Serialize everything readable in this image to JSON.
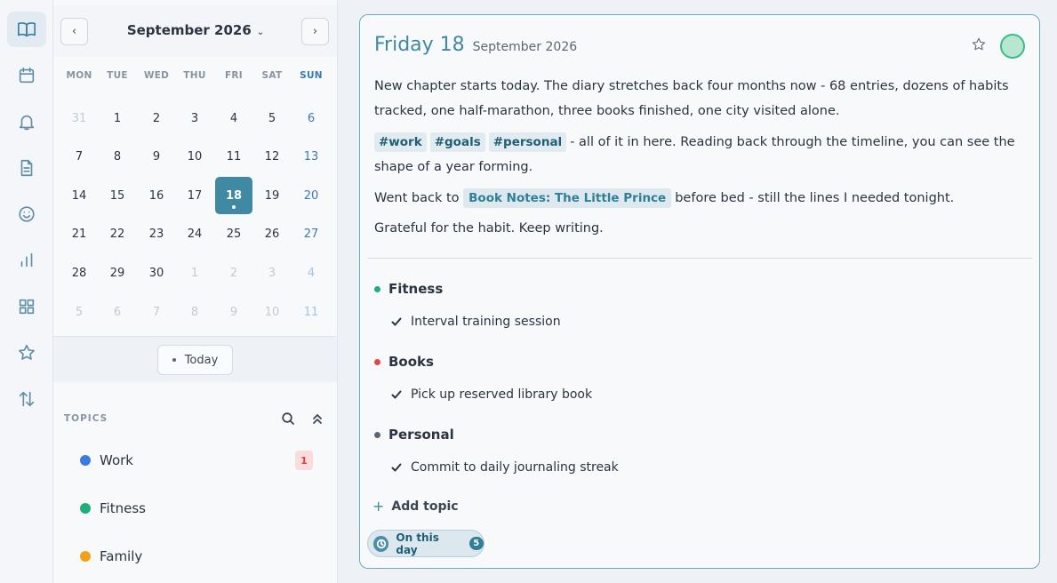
{
  "rail": {
    "items": [
      {
        "name": "journal",
        "icon": "book-open-icon",
        "active": true
      },
      {
        "name": "calendar",
        "icon": "calendar-icon",
        "active": false
      },
      {
        "name": "reminders",
        "icon": "bell-icon",
        "active": false
      },
      {
        "name": "notes",
        "icon": "document-icon",
        "active": false
      },
      {
        "name": "mood",
        "icon": "smiley-icon",
        "active": false
      },
      {
        "name": "stats",
        "icon": "bar-chart-icon",
        "active": false
      },
      {
        "name": "dashboard",
        "icon": "grid-icon",
        "active": false
      },
      {
        "name": "favorites",
        "icon": "star-icon",
        "active": false
      },
      {
        "name": "sync",
        "icon": "arrows-up-down-icon",
        "active": false
      }
    ]
  },
  "calendar": {
    "month_label": "September 2026",
    "prev_icon": "chevron-left-icon",
    "next_icon": "chevron-right-icon",
    "weekdays": [
      "MON",
      "TUE",
      "WED",
      "THU",
      "FRI",
      "SAT",
      "SUN"
    ],
    "weeks": [
      [
        {
          "d": "31",
          "other": true
        },
        {
          "d": "1"
        },
        {
          "d": "2"
        },
        {
          "d": "3"
        },
        {
          "d": "4"
        },
        {
          "d": "5"
        },
        {
          "d": "6"
        }
      ],
      [
        {
          "d": "7"
        },
        {
          "d": "8"
        },
        {
          "d": "9"
        },
        {
          "d": "10"
        },
        {
          "d": "11"
        },
        {
          "d": "12"
        },
        {
          "d": "13"
        }
      ],
      [
        {
          "d": "14"
        },
        {
          "d": "15"
        },
        {
          "d": "16"
        },
        {
          "d": "17"
        },
        {
          "d": "18",
          "selected": true
        },
        {
          "d": "19"
        },
        {
          "d": "20"
        }
      ],
      [
        {
          "d": "21"
        },
        {
          "d": "22"
        },
        {
          "d": "23"
        },
        {
          "d": "24"
        },
        {
          "d": "25"
        },
        {
          "d": "26"
        },
        {
          "d": "27"
        }
      ],
      [
        {
          "d": "28"
        },
        {
          "d": "29"
        },
        {
          "d": "30"
        },
        {
          "d": "1",
          "other": true
        },
        {
          "d": "2",
          "other": true
        },
        {
          "d": "3",
          "other": true
        },
        {
          "d": "4",
          "other": true
        }
      ],
      [
        {
          "d": "5",
          "other": true
        },
        {
          "d": "6",
          "other": true
        },
        {
          "d": "7",
          "other": true
        },
        {
          "d": "8",
          "other": true
        },
        {
          "d": "9",
          "other": true
        },
        {
          "d": "10",
          "other": true
        },
        {
          "d": "11",
          "other": true
        }
      ]
    ],
    "today_label": "Today"
  },
  "topics": {
    "label": "TOPICS",
    "items": [
      {
        "name": "Work",
        "color": "#3b7ae0",
        "badge": "1"
      },
      {
        "name": "Fitness",
        "color": "#1fae7a",
        "badge": ""
      },
      {
        "name": "Family",
        "color": "#f0a11a",
        "badge": ""
      }
    ]
  },
  "entry": {
    "day_title": "Friday 18",
    "month_title": "September 2026",
    "p1": "New chapter starts today. The diary stretches back four months now - 68 entries, dozens of habits tracked, one half-marathon, three books finished, one city visited alone.",
    "tags": [
      "#work",
      "#goals",
      "#personal"
    ],
    "p2_text": "- all of it in here. Reading back through the timeline, you can see the shape of a year forming.",
    "p3_before": "Went back to",
    "p3_link": "Book Notes: The Little Prince",
    "p3_after": "before bed - still the lines I needed tonight.",
    "p4": "Grateful for the habit. Keep writing.",
    "mood_color": "#b8e7d1"
  },
  "timeline": [
    {
      "topic": "Fitness",
      "color": "#1fae7a",
      "task": "Interval training session"
    },
    {
      "topic": "Books",
      "color": "#e04848",
      "task": "Pick up reserved library book"
    },
    {
      "topic": "Personal",
      "color": "#5c6673",
      "task": "Commit to daily journaling streak"
    }
  ],
  "add_topic_label": "Add topic",
  "on_this_day": {
    "label": "On this day",
    "count": "5"
  }
}
